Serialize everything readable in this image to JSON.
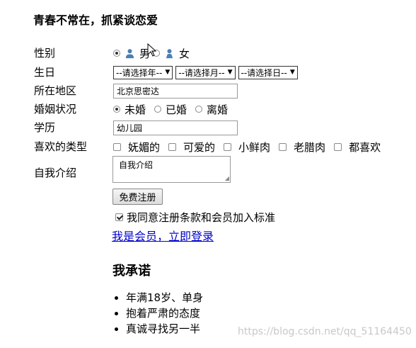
{
  "title": "青春不常在，抓紧谈恋爱",
  "form": {
    "gender": {
      "label": "性别",
      "male": "男",
      "female": "女"
    },
    "birthday": {
      "label": "生日",
      "year": "--请选择年--",
      "month": "--请选择月--",
      "day": "--请选择日--"
    },
    "region": {
      "label": "所在地区",
      "value": "北京思密达"
    },
    "marital": {
      "label": "婚姻状况",
      "options": [
        "未婚",
        "已婚",
        "离婚"
      ]
    },
    "education": {
      "label": "学历",
      "value": "幼儿园"
    },
    "likes": {
      "label": "喜欢的类型",
      "options": [
        "妩媚的",
        "可爱的",
        "小鲜肉",
        "老腊肉",
        "都喜欢"
      ]
    },
    "intro": {
      "label": "自我介绍",
      "value": "自我介绍"
    },
    "submit": "免费注册",
    "agree": "我同意注册条款和会员加入标准",
    "login_link": "我是会员，立即登录"
  },
  "promise": {
    "heading": "我承诺",
    "items": [
      "年满18岁、单身",
      "抱着严肃的态度",
      "真诚寻找另一半"
    ]
  },
  "watermark": "https://blog.csdn.net/qq_51164450",
  "colors": {
    "link": "#0000cc",
    "icon": "#4a7fb5"
  }
}
